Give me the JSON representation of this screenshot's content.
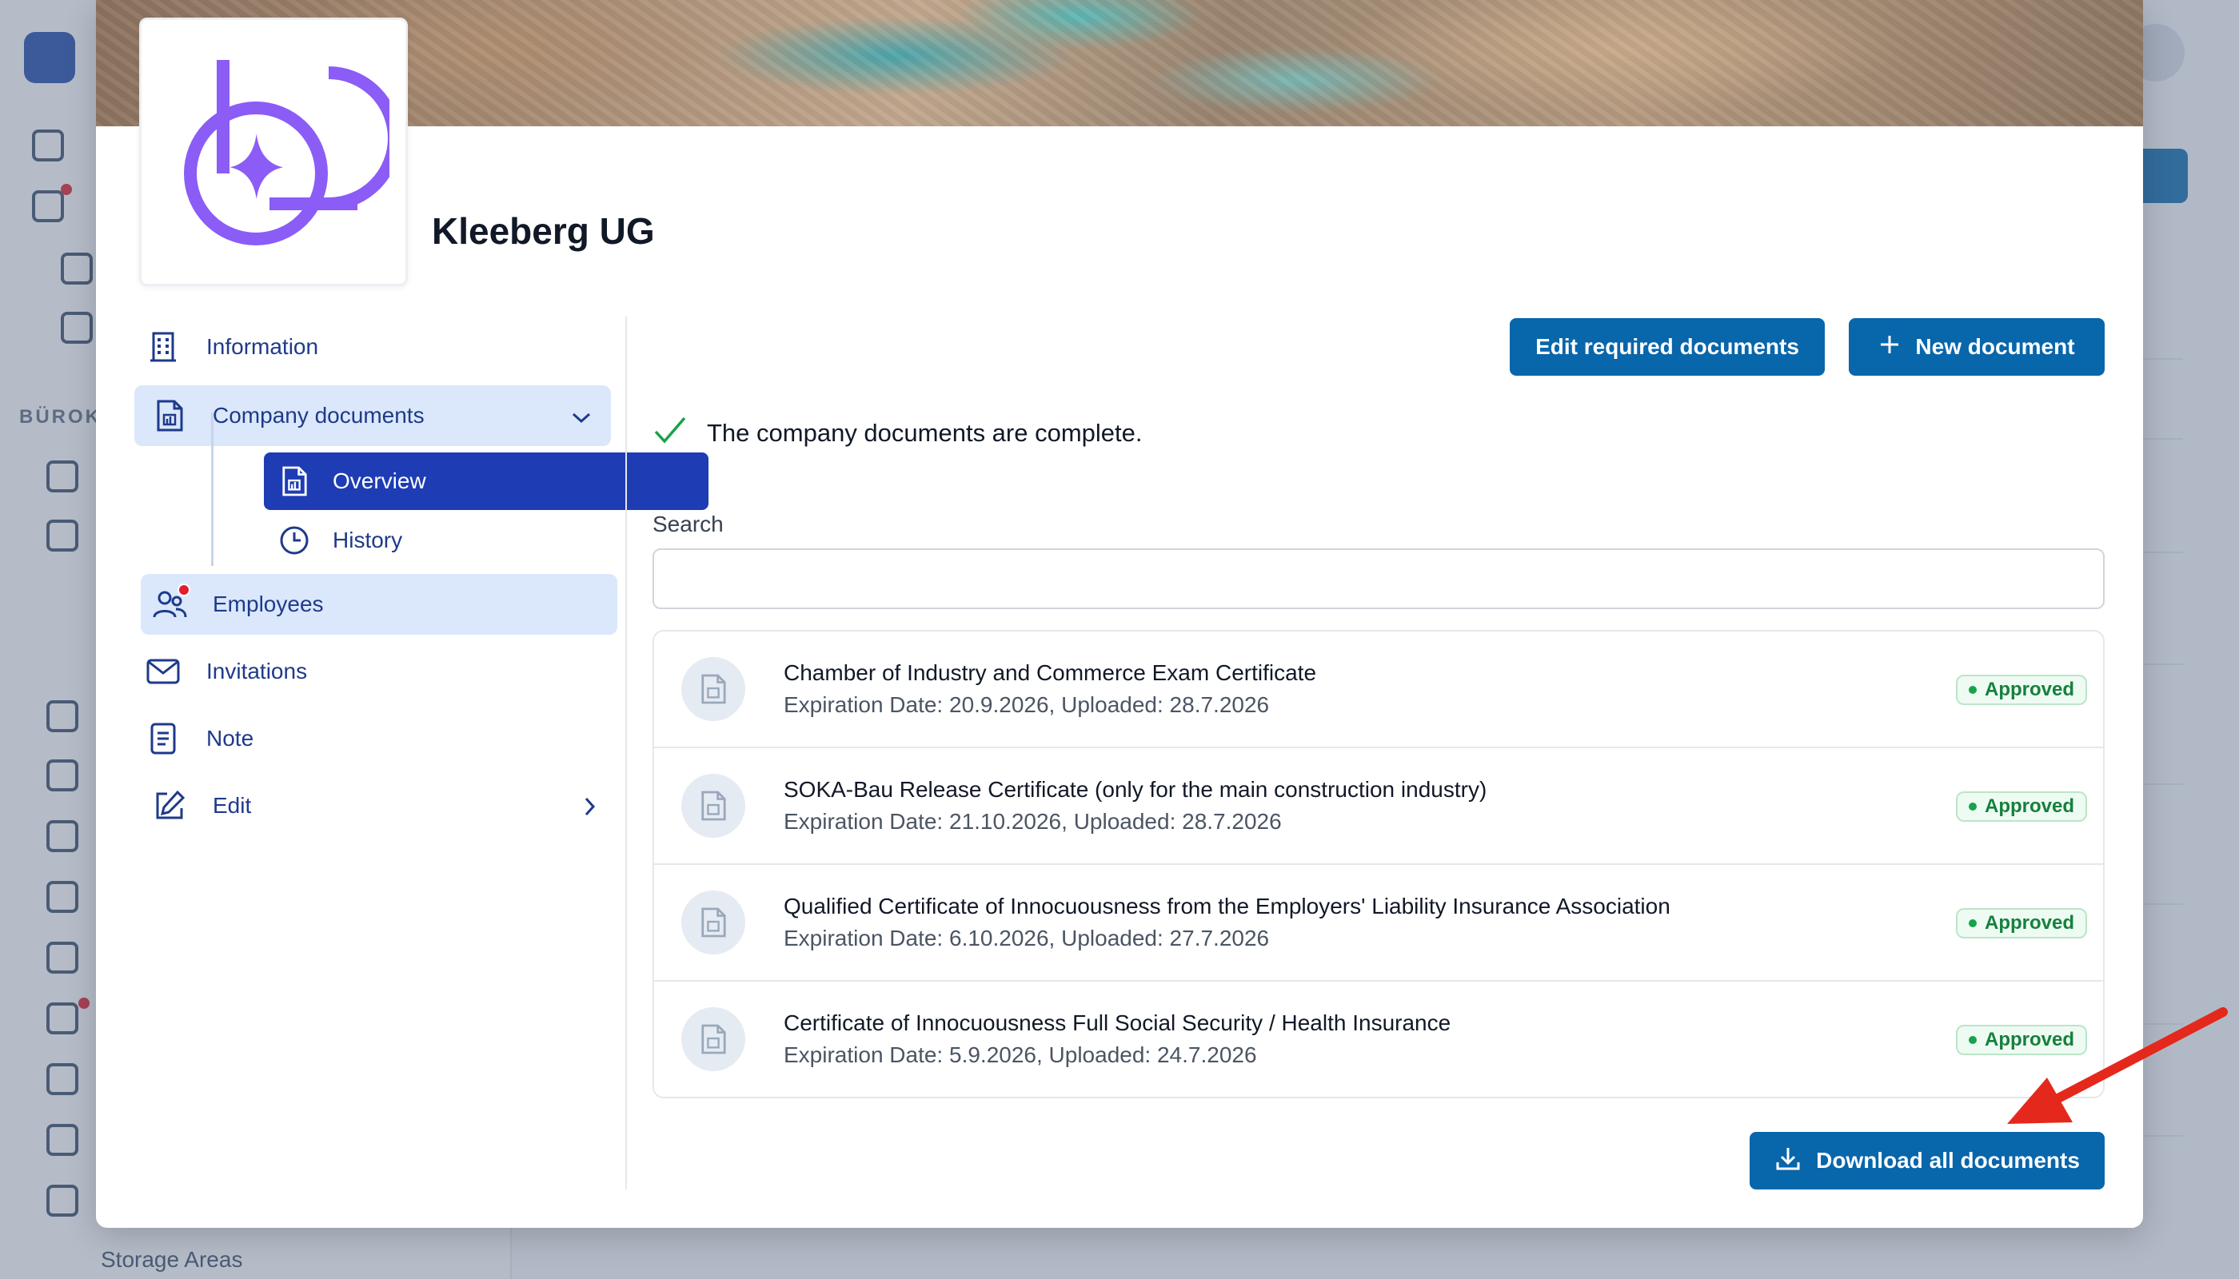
{
  "background": {
    "sidebar_section": "BÜROKR",
    "storage_label": "Storage Areas"
  },
  "company": {
    "name": "Kleeberg UG"
  },
  "nav": {
    "items": [
      {
        "label": "Information",
        "icon": "building-icon"
      },
      {
        "label": "Company documents",
        "icon": "document-icon",
        "expanded": true
      },
      {
        "label": "Overview",
        "icon": "document-icon",
        "selected": true
      },
      {
        "label": "History",
        "icon": "clock-icon"
      },
      {
        "label": "Employees",
        "icon": "users-icon"
      },
      {
        "label": "Invitations",
        "icon": "mail-icon"
      },
      {
        "label": "Note",
        "icon": "note-icon"
      },
      {
        "label": "Edit",
        "icon": "pencil-icon"
      }
    ]
  },
  "toolbar": {
    "edit_required_label": "Edit required documents",
    "new_document_label": "New document"
  },
  "status_message": "The company documents are complete.",
  "search": {
    "label": "Search",
    "placeholder": "",
    "value": ""
  },
  "documents": [
    {
      "title": "Chamber of Industry and Commerce Exam Certificate",
      "meta": "Expiration Date: 20.9.2026, Uploaded: 28.7.2026",
      "status": "Approved"
    },
    {
      "title": "SOKA-Bau Release Certificate (only for the main construction industry)",
      "meta": "Expiration Date: 21.10.2026, Uploaded: 28.7.2026",
      "status": "Approved"
    },
    {
      "title": "Qualified Certificate of Innocuousness from the Employers' Liability Insurance Association",
      "meta": "Expiration Date: 6.10.2026, Uploaded: 27.7.2026",
      "status": "Approved"
    },
    {
      "title": "Certificate of Innocuousness Full Social Security / Health Insurance",
      "meta": "Expiration Date: 5.9.2026, Uploaded: 24.7.2026",
      "status": "Approved"
    }
  ],
  "footer": {
    "download_all_label": "Download all documents"
  },
  "colors": {
    "primary": "#0866ab",
    "nav_selected": "#1e3cb4",
    "nav_highlight": "#dbe8fb",
    "approved": "#15803d",
    "logo_purple": "#8b5cf6",
    "annotation_arrow": "#e5281c"
  }
}
